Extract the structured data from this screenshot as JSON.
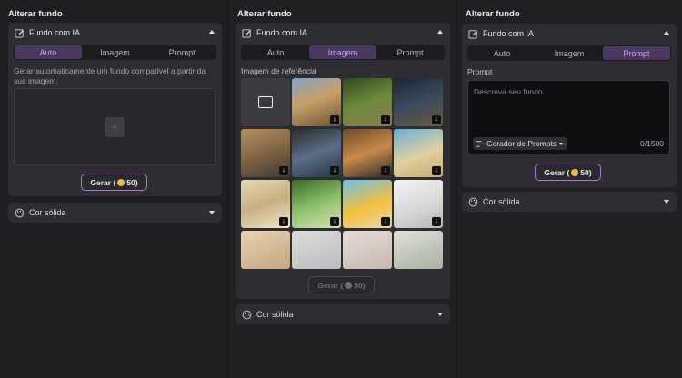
{
  "panel1": {
    "title": "Alterar fundo",
    "ai_section": "Fundo com IA",
    "tabs": [
      "Auto",
      "Imagem",
      "Prompt"
    ],
    "active_tab": "Auto",
    "description": "Gerar automaticamente um fundo compatível a partir da sua imagem.",
    "generate_label": "Gerar (",
    "generate_cost": "50)",
    "solid_section": "Cor sólida"
  },
  "panel2": {
    "title": "Alterar fundo",
    "ai_section": "Fundo com IA",
    "tabs": [
      "Auto",
      "Imagem",
      "Prompt"
    ],
    "active_tab": "Imagem",
    "reference_label": "Imagem de referência",
    "thumbnails": [
      "upload",
      "city-street",
      "forest-road",
      "night-city",
      "old-town",
      "perfume-rocks",
      "camera-sand",
      "perfume-beach",
      "sunglasses-cloth",
      "bottle-leaves",
      "drink-beach",
      "laptop-desk",
      "beige-wall",
      "white-bottle",
      "hand-bottle",
      "plant-bottle"
    ],
    "generate_label": "Gerar (",
    "generate_cost": "50)",
    "solid_section": "Cor sólida"
  },
  "panel3": {
    "title": "Alterar fundo",
    "ai_section": "Fundo com IA",
    "tabs": [
      "Auto",
      "Imagem",
      "Prompt"
    ],
    "active_tab": "Prompt",
    "prompt_label": "Prompt",
    "prompt_placeholder": "Descreva seu fundo.",
    "prompt_generator": "Gerador de Prompts",
    "counter": "0/1500",
    "generate_label": "Gerar (",
    "generate_cost": "50)",
    "solid_section": "Cor sólida"
  },
  "colors": {
    "accent": "#a67ad9",
    "tab_active_bg": "#4a3860",
    "coin": "#e8b84a"
  }
}
